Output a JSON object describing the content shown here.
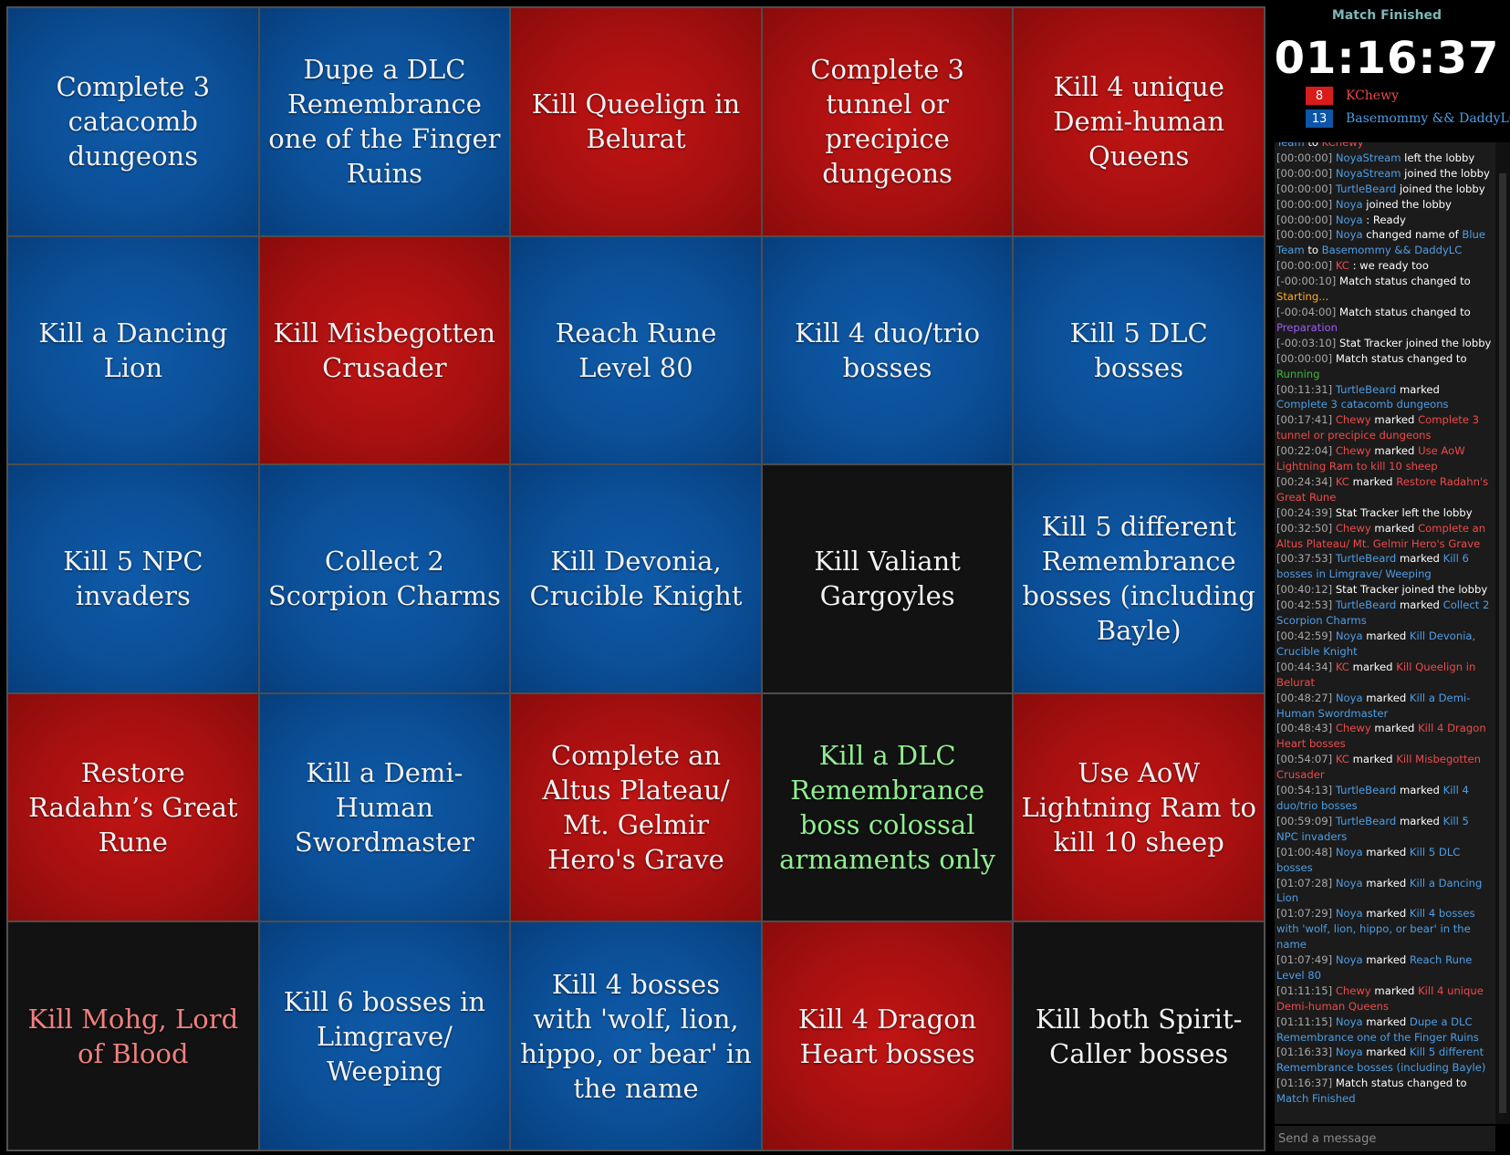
{
  "board": {
    "cells": [
      {
        "text": "Complete 3 catacomb dungeons",
        "color": "blue"
      },
      {
        "text": "Dupe a DLC Remembrance one of the Finger Ruins",
        "color": "blue"
      },
      {
        "text": "Kill Queelign in Belurat",
        "color": "red"
      },
      {
        "text": "Complete 3 tunnel or precipice dungeons",
        "color": "red"
      },
      {
        "text": "Kill 4 unique Demi-human Queens",
        "color": "red"
      },
      {
        "text": "Kill a Dancing Lion",
        "color": "blue"
      },
      {
        "text": "Kill Misbegotten Crusader",
        "color": "red"
      },
      {
        "text": "Reach Rune Level 80",
        "color": "blue"
      },
      {
        "text": "Kill 4 duo/trio bosses",
        "color": "blue"
      },
      {
        "text": "Kill 5 DLC bosses",
        "color": "blue"
      },
      {
        "text": "Kill 5 NPC invaders",
        "color": "blue"
      },
      {
        "text": "Collect 2 Scorpion Charms",
        "color": "blue"
      },
      {
        "text": "Kill Devonia, Crucible Knight",
        "color": "blue"
      },
      {
        "text": "Kill Valiant Gargoyles",
        "color": "black"
      },
      {
        "text": "Kill 5 different Remembrance bosses (including Bayle)",
        "color": "blue"
      },
      {
        "text": "Restore Radahn’s Great Rune",
        "color": "red"
      },
      {
        "text": "Kill a Demi-Human Swordmaster",
        "color": "blue"
      },
      {
        "text": "Complete an Altus Plateau/ Mt. Gelmir Hero's Grave",
        "color": "red"
      },
      {
        "text": "Kill a DLC Remembrance boss colossal armaments only",
        "color": "black",
        "text_color": "green"
      },
      {
        "text": "Use AoW Lightning Ram to kill 10 sheep",
        "color": "red"
      },
      {
        "text": "Kill Mohg, Lord of Blood",
        "color": "black",
        "text_color": "salmon"
      },
      {
        "text": "Kill 6 bosses in Limgrave/ Weeping",
        "color": "blue"
      },
      {
        "text": "Kill 4 bosses with 'wolf, lion, hippo, or bear' in the name",
        "color": "blue"
      },
      {
        "text": "Kill 4 Dragon Heart bosses",
        "color": "red"
      },
      {
        "text": "Kill both Spirit-Caller bosses",
        "color": "black"
      }
    ]
  },
  "status": {
    "title": "Match Finished",
    "timer": "01:16:37"
  },
  "teams": [
    {
      "score": "8",
      "name": "KChewy",
      "color": "#d81b1b",
      "text_color": "#ee4a4a"
    },
    {
      "score": "13",
      "name": "Basemommy && DaddyLC",
      "color": "#0d55a7",
      "text_color": "#4d9ee6"
    }
  ],
  "chat": {
    "placeholder": "Send a message",
    "messages": [
      [
        [
          "Team",
          "b"
        ],
        [
          " to ",
          "w"
        ],
        [
          "KChewy",
          "r"
        ]
      ],
      [
        [
          "[00:00:00] ",
          "t"
        ],
        [
          "NoyaStream",
          "b"
        ],
        [
          " left the lobby",
          "w"
        ]
      ],
      [
        [
          "[00:00:00] ",
          "t"
        ],
        [
          "NoyaStream",
          "b"
        ],
        [
          " joined the lobby",
          "w"
        ]
      ],
      [
        [
          "[00:00:00] ",
          "t"
        ],
        [
          "TurtleBeard",
          "b"
        ],
        [
          " joined the lobby",
          "w"
        ]
      ],
      [
        [
          "[00:00:00] ",
          "t"
        ],
        [
          "Noya",
          "b"
        ],
        [
          " joined the lobby",
          "w"
        ]
      ],
      [
        [
          "[00:00:00] ",
          "t"
        ],
        [
          "Noya",
          "b"
        ],
        [
          " : Ready",
          "w"
        ]
      ],
      [
        [
          "[00:00:00] ",
          "t"
        ],
        [
          "Noya",
          "b"
        ],
        [
          " changed name of ",
          "w"
        ],
        [
          "Blue Team",
          "b"
        ],
        [
          " to ",
          "w"
        ],
        [
          "Basemommy && DaddyLC",
          "b"
        ]
      ],
      [
        [
          "[00:00:00] ",
          "t"
        ],
        [
          "KC",
          "r"
        ],
        [
          " : we ready too",
          "w"
        ]
      ],
      [
        [
          "[-00:00:10] ",
          "t"
        ],
        [
          "Match status changed to ",
          "w"
        ],
        [
          "Starting...",
          "o"
        ]
      ],
      [
        [
          "[-00:04:00] ",
          "t"
        ],
        [
          "Match status changed to ",
          "w"
        ],
        [
          "Preparation",
          "p"
        ]
      ],
      [
        [
          "[-00:03:10] ",
          "t"
        ],
        [
          "Stat Tracker joined the lobby",
          "w"
        ]
      ],
      [
        [
          "[00:00:00] ",
          "t"
        ],
        [
          "Match status changed to ",
          "w"
        ],
        [
          "Running",
          "g"
        ]
      ],
      [
        [
          "[00:11:31] ",
          "t"
        ],
        [
          "TurtleBeard",
          "b"
        ],
        [
          " marked ",
          "w"
        ],
        [
          "Complete 3 catacomb dungeons",
          "b"
        ]
      ],
      [
        [
          "[00:17:41] ",
          "t"
        ],
        [
          "Chewy",
          "r"
        ],
        [
          " marked ",
          "w"
        ],
        [
          "Complete 3 tunnel or precipice dungeons",
          "r"
        ]
      ],
      [
        [
          "[00:22:04] ",
          "t"
        ],
        [
          "Chewy",
          "r"
        ],
        [
          " marked ",
          "w"
        ],
        [
          "Use AoW Lightning Ram to kill 10 sheep",
          "r"
        ]
      ],
      [
        [
          "[00:24:34] ",
          "t"
        ],
        [
          "KC",
          "r"
        ],
        [
          " marked ",
          "w"
        ],
        [
          "Restore Radahn's Great Rune",
          "r"
        ]
      ],
      [
        [
          "[00:24:39] ",
          "t"
        ],
        [
          "Stat Tracker left the lobby",
          "w"
        ]
      ],
      [
        [
          "[00:32:50] ",
          "t"
        ],
        [
          "Chewy",
          "r"
        ],
        [
          " marked ",
          "w"
        ],
        [
          "Complete an Altus Plateau/ Mt. Gelmir Hero's Grave",
          "r"
        ]
      ],
      [
        [
          "[00:37:53] ",
          "t"
        ],
        [
          "TurtleBeard",
          "b"
        ],
        [
          " marked ",
          "w"
        ],
        [
          "Kill 6 bosses in Limgrave/ Weeping",
          "b"
        ]
      ],
      [
        [
          "[00:40:12] ",
          "t"
        ],
        [
          "Stat Tracker joined the lobby",
          "w"
        ]
      ],
      [
        [
          "[00:42:53] ",
          "t"
        ],
        [
          "TurtleBeard",
          "b"
        ],
        [
          " marked ",
          "w"
        ],
        [
          "Collect 2 Scorpion Charms",
          "b"
        ]
      ],
      [
        [
          "[00:42:59] ",
          "t"
        ],
        [
          "Noya",
          "b"
        ],
        [
          " marked ",
          "w"
        ],
        [
          "Kill Devonia, Crucible Knight",
          "b"
        ]
      ],
      [
        [
          "[00:44:34] ",
          "t"
        ],
        [
          "KC",
          "r"
        ],
        [
          " marked ",
          "w"
        ],
        [
          "Kill Queelign in Belurat",
          "r"
        ]
      ],
      [
        [
          "[00:48:27] ",
          "t"
        ],
        [
          "Noya",
          "b"
        ],
        [
          " marked ",
          "w"
        ],
        [
          "Kill a Demi-Human Swordmaster",
          "b"
        ]
      ],
      [
        [
          "[00:48:43] ",
          "t"
        ],
        [
          "Chewy",
          "r"
        ],
        [
          " marked ",
          "w"
        ],
        [
          "Kill 4 Dragon Heart bosses",
          "r"
        ]
      ],
      [
        [
          "[00:54:07] ",
          "t"
        ],
        [
          "KC",
          "r"
        ],
        [
          " marked ",
          "w"
        ],
        [
          "Kill Misbegotten Crusader",
          "r"
        ]
      ],
      [
        [
          "[00:54:13] ",
          "t"
        ],
        [
          "TurtleBeard",
          "b"
        ],
        [
          " marked ",
          "w"
        ],
        [
          "Kill 4 duo/trio bosses",
          "b"
        ]
      ],
      [
        [
          "[00:59:09] ",
          "t"
        ],
        [
          "TurtleBeard",
          "b"
        ],
        [
          " marked ",
          "w"
        ],
        [
          "Kill 5 NPC invaders",
          "b"
        ]
      ],
      [
        [
          "[01:00:48] ",
          "t"
        ],
        [
          "Noya",
          "b"
        ],
        [
          " marked ",
          "w"
        ],
        [
          "Kill 5 DLC bosses",
          "b"
        ]
      ],
      [
        [
          "[01:07:28] ",
          "t"
        ],
        [
          "Noya",
          "b"
        ],
        [
          " marked ",
          "w"
        ],
        [
          "Kill a Dancing Lion",
          "b"
        ]
      ],
      [
        [
          "[01:07:29] ",
          "t"
        ],
        [
          "Noya",
          "b"
        ],
        [
          " marked ",
          "w"
        ],
        [
          "Kill 4 bosses with 'wolf, lion, hippo, or bear' in the name",
          "b"
        ]
      ],
      [
        [
          "[01:07:49] ",
          "t"
        ],
        [
          "Noya",
          "b"
        ],
        [
          " marked ",
          "w"
        ],
        [
          "Reach Rune Level 80",
          "b"
        ]
      ],
      [
        [
          "[01:11:15] ",
          "t"
        ],
        [
          "Chewy",
          "r"
        ],
        [
          " marked ",
          "w"
        ],
        [
          "Kill 4 unique Demi-human Queens",
          "r"
        ]
      ],
      [
        [
          "[01:11:15] ",
          "t"
        ],
        [
          "Noya",
          "b"
        ],
        [
          " marked ",
          "w"
        ],
        [
          "Dupe a DLC Remembrance one of the Finger Ruins",
          "b"
        ]
      ],
      [
        [
          "[01:16:33] ",
          "t"
        ],
        [
          "Noya",
          "b"
        ],
        [
          " marked ",
          "w"
        ],
        [
          "Kill 5 different Remembrance bosses (including Bayle)",
          "b"
        ]
      ],
      [
        [
          "[01:16:37] ",
          "t"
        ],
        [
          "Match status changed to ",
          "w"
        ],
        [
          "Match Finished",
          "b"
        ]
      ]
    ]
  }
}
